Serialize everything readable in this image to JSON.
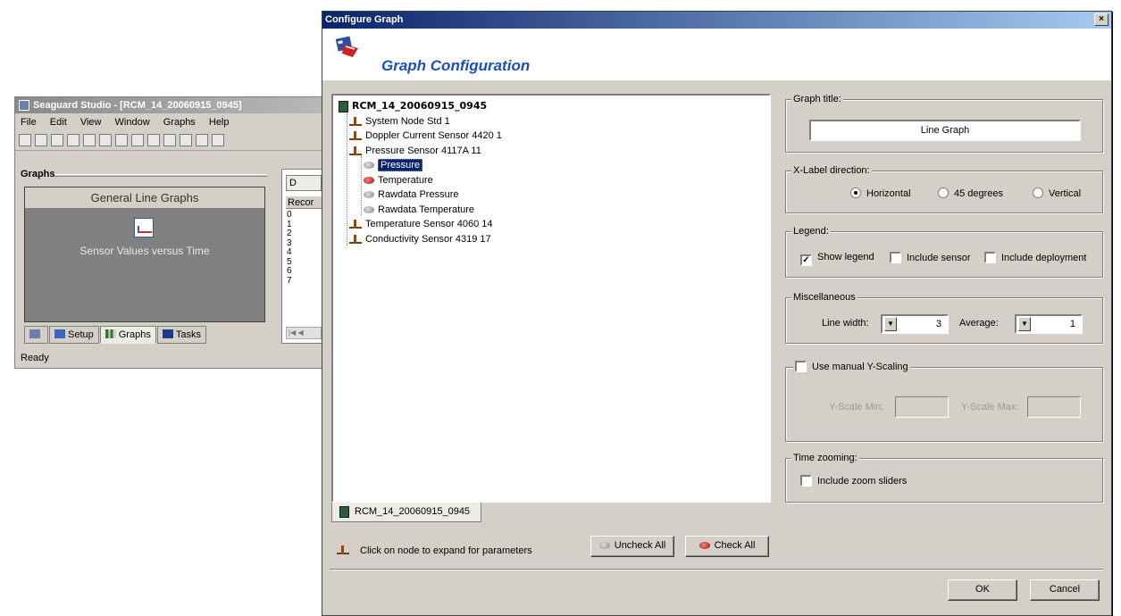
{
  "background_app": {
    "title": "Seaguard Studio - [RCM_14_20060915_0945]",
    "menu": [
      "File",
      "Edit",
      "View",
      "Window",
      "Graphs",
      "Help"
    ],
    "panel_title": "Graphs",
    "list_header": "General Line Graphs",
    "graph_item_label": "Sensor Values versus Time",
    "tabs": [
      "Setup",
      "Graphs",
      "Tasks"
    ],
    "status": "Ready",
    "records_button": "D",
    "records_header": "Recor",
    "record_rows": [
      "0",
      "1",
      "2",
      "3",
      "4",
      "5",
      "6",
      "7"
    ]
  },
  "dialog": {
    "title": "Configure Graph",
    "close_glyph": "×",
    "header_title": "Graph Configuration",
    "tree": {
      "root": "RCM_14_20060915_0945",
      "nodes": [
        {
          "label": "System Node Std 1",
          "kind": "sensor"
        },
        {
          "label": "Doppler Current Sensor 4420 1",
          "kind": "sensor"
        },
        {
          "label": "Pressure Sensor 4117A 11",
          "kind": "sensor"
        },
        {
          "label": "Pressure",
          "kind": "param",
          "selected": true
        },
        {
          "label": "Temperature",
          "kind": "param",
          "checked": true
        },
        {
          "label": "Rawdata Pressure",
          "kind": "param"
        },
        {
          "label": "Rawdata Temperature",
          "kind": "param"
        },
        {
          "label": "Temperature Sensor 4060 14",
          "kind": "sensor"
        },
        {
          "label": "Conductivity Sensor 4319 17",
          "kind": "sensor"
        }
      ]
    },
    "tree_tab": "RCM_14_20060915_0945",
    "hint": "Click on node to expand for parameters",
    "uncheck_all": "Uncheck All",
    "check_all": "Check All",
    "ok": "OK",
    "cancel": "Cancel",
    "graph_title": {
      "label": "Graph title:",
      "value": "Line Graph"
    },
    "xlabel": {
      "label": "X-Label direction:",
      "options": [
        "Horizontal",
        "45 degrees",
        "Vertical"
      ],
      "selected": "Horizontal"
    },
    "legend": {
      "label": "Legend:",
      "show_legend": "Show legend",
      "show_legend_checked": true,
      "include_sensor": "Include sensor",
      "include_deployment": "Include deployment"
    },
    "misc": {
      "label": "Miscellaneous",
      "line_width_label": "Line width:",
      "line_width": "3",
      "average_label": "Average:",
      "average": "1"
    },
    "yscale": {
      "label": "Use manual Y-Scaling",
      "min_label": "Y-Scale Min:",
      "max_label": "Y-Scale Max:"
    },
    "zoom": {
      "label": "Time zooming:",
      "include_sliders": "Include zoom sliders"
    }
  }
}
